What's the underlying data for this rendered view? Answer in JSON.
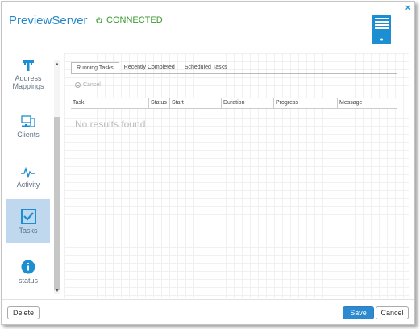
{
  "header": {
    "title": "PreviewServer",
    "status_text": "CONNECTED",
    "status_color": "#3a9b2d"
  },
  "sidebar": {
    "items": [
      {
        "label": "Address\nMappings",
        "icon": "address-mappings-icon"
      },
      {
        "label": "Clients",
        "icon": "clients-icon"
      },
      {
        "label": "Activity",
        "icon": "activity-icon"
      },
      {
        "label": "Tasks",
        "icon": "tasks-icon",
        "active": true
      },
      {
        "label": "status",
        "icon": "info-icon"
      }
    ]
  },
  "tabs": [
    "Running Tasks",
    "Recently Completed",
    "Scheduled Tasks"
  ],
  "toolbar": {
    "cancel_label": "Cancel"
  },
  "grid": {
    "columns": [
      "Task",
      "Status",
      "Start",
      "Duration",
      "Progress",
      "Message"
    ],
    "empty_text": "No results found"
  },
  "footer": {
    "delete_label": "Delete",
    "save_label": "Save",
    "cancel_label": "Cancel"
  },
  "colors": {
    "accent": "#2487c9",
    "active_nav": "#bfd8ee"
  }
}
